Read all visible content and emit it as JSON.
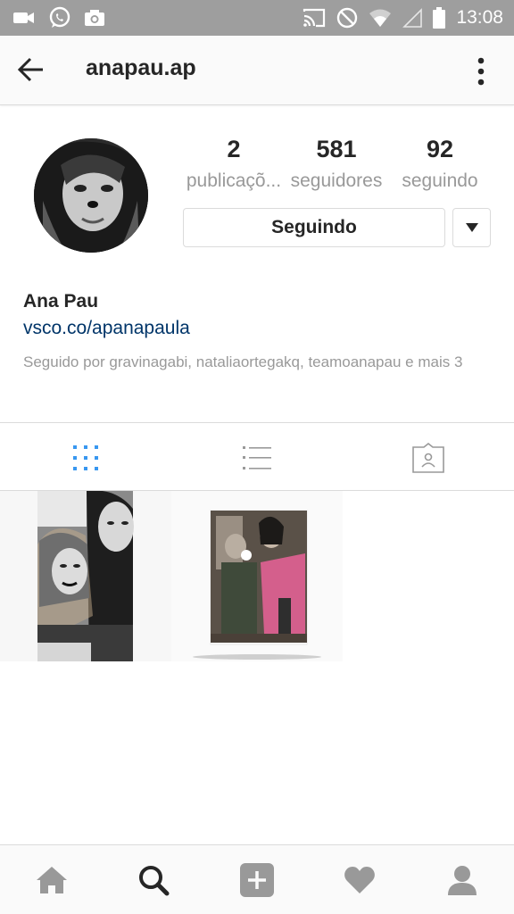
{
  "status_bar": {
    "time": "13:08",
    "left_icons": [
      "video-icon",
      "whatsapp-icon",
      "camera-icon"
    ],
    "right_icons": [
      "cast-icon",
      "do-not-disturb-icon",
      "wifi-icon",
      "signal-icon",
      "battery-icon"
    ]
  },
  "header": {
    "username": "anapau.ap",
    "back_icon": "arrow-left-icon",
    "more_icon": "more-vertical-icon"
  },
  "profile": {
    "stats": [
      {
        "value": "2",
        "label": "publicaçõ..."
      },
      {
        "value": "581",
        "label": "seguidores"
      },
      {
        "value": "92",
        "label": "seguindo"
      }
    ],
    "follow_button_label": "Seguindo",
    "full_name": "Ana Pau",
    "bio_link": "vsco.co/apanapaula",
    "followed_by": "Seguido por gravinagabi, nataliaortegakq, teamoanapau e mais 3"
  },
  "tabs": [
    {
      "name": "grid",
      "icon": "grid-icon",
      "active": true
    },
    {
      "name": "list",
      "icon": "list-icon",
      "active": false
    },
    {
      "name": "tagged",
      "icon": "tagged-person-icon",
      "active": false
    }
  ],
  "bottom_nav": [
    "home-icon",
    "search-icon",
    "add-post-icon",
    "heart-icon",
    "profile-icon"
  ],
  "colors": {
    "status_bar": "#9e9e9e",
    "link": "#003569",
    "active_tab": "#3897f0",
    "muted_text": "#999999",
    "border": "#dbdbdb"
  }
}
